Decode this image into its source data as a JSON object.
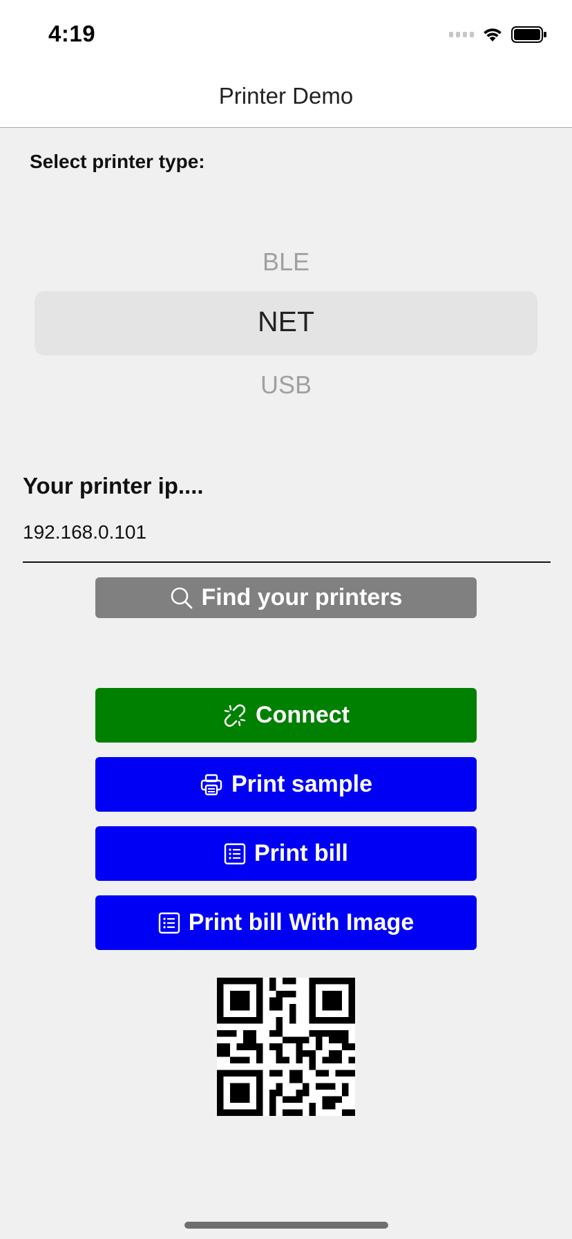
{
  "status_bar": {
    "time": "4:19"
  },
  "nav": {
    "title": "Printer Demo"
  },
  "printer_type": {
    "label": "Select printer type:",
    "options": [
      "BLE",
      "NET",
      "USB"
    ],
    "selected": "NET"
  },
  "ip": {
    "label": "Your printer ip....",
    "value": "192.168.0.101"
  },
  "buttons": {
    "find": "Find your printers",
    "connect": "Connect",
    "print_sample": "Print sample",
    "print_bill": "Print bill",
    "print_bill_image": "Print bill With Image"
  },
  "colors": {
    "find": "#808080",
    "connect": "#008000",
    "print": "#0000f5"
  },
  "icons": {
    "find": "search-icon",
    "connect": "link-icon",
    "print_sample": "printer-icon",
    "print_bill": "receipt-icon",
    "print_bill_image": "receipt-icon"
  }
}
